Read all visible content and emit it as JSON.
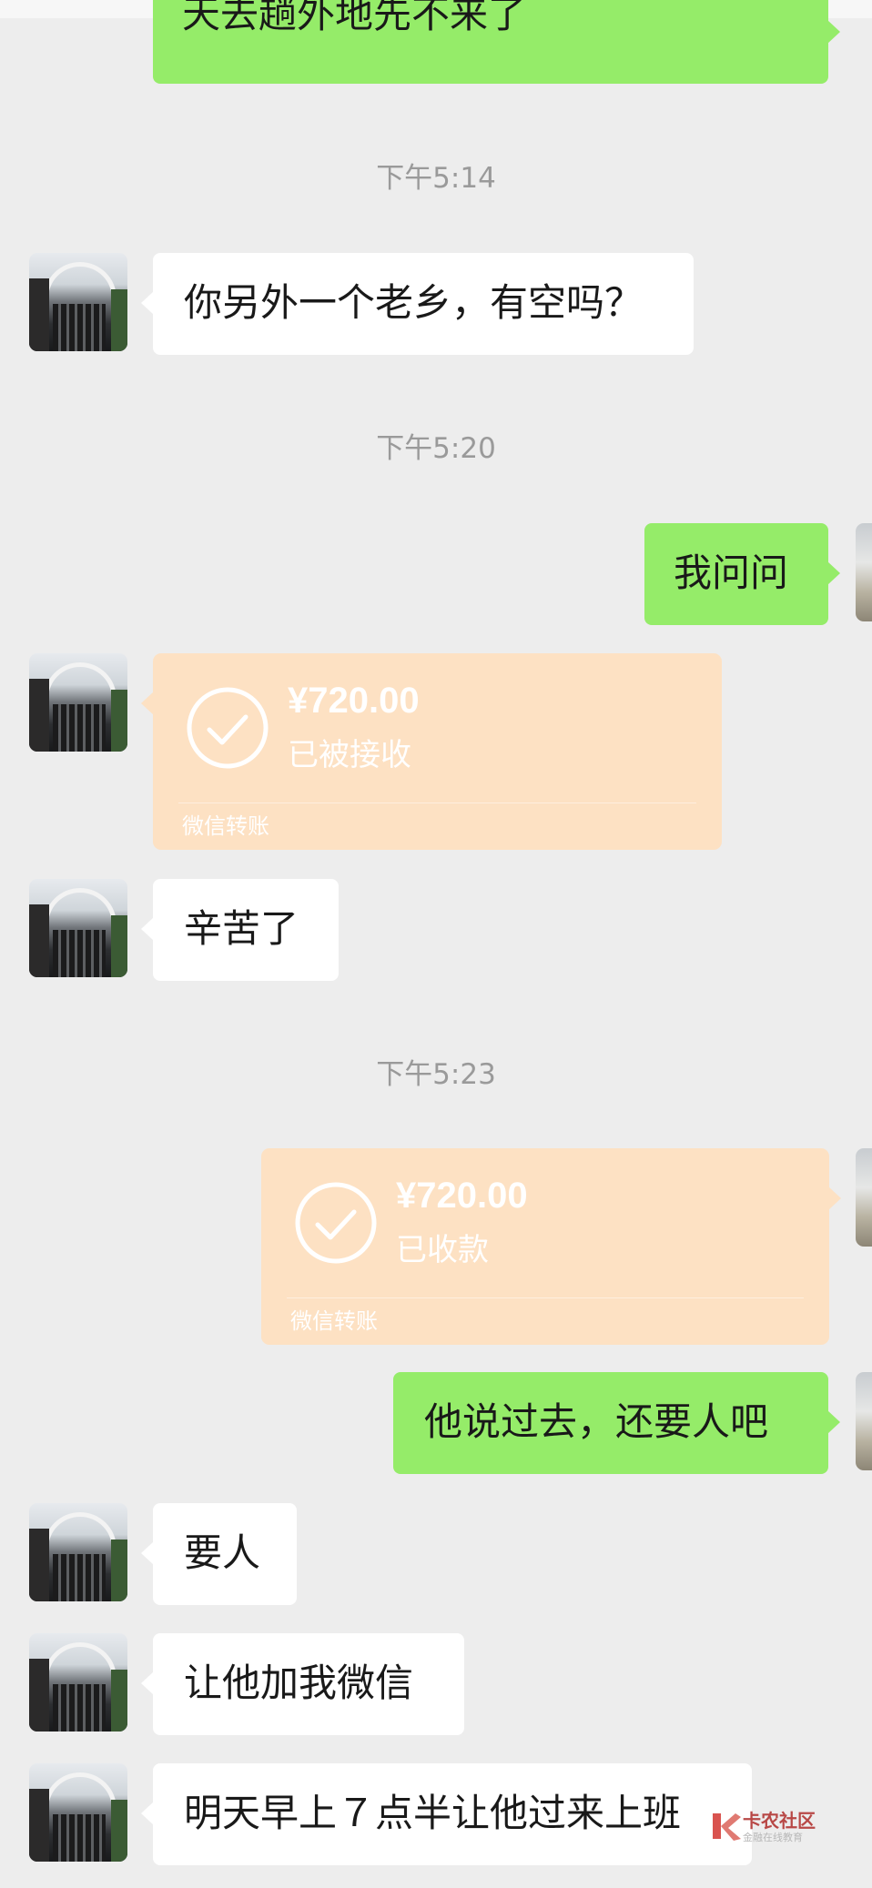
{
  "messages": {
    "m0": "天去趟外地先不来了",
    "t1": "下午5:14",
    "m1": "你另外一个老乡，有空吗？",
    "t2": "下午5:20",
    "m2": "我问问",
    "tr1": {
      "amount": "¥720.00",
      "status": "已被接收",
      "footer": "微信转账"
    },
    "m3": "辛苦了",
    "t3": "下午5:23",
    "tr2": {
      "amount": "¥720.00",
      "status": "已收款",
      "footer": "微信转账"
    },
    "m4": "他说过去，还要人吧",
    "m5": "要人",
    "m6": "让他加我微信",
    "m7": "明天早上７点半让他过来上班"
  },
  "watermark": {
    "title": "卡农社区",
    "subtitle": "金融在线教育"
  },
  "colors": {
    "background": "#ededed",
    "green_bubble": "#95ec69",
    "white_bubble": "#ffffff",
    "transfer_card": "#fde1c3"
  }
}
